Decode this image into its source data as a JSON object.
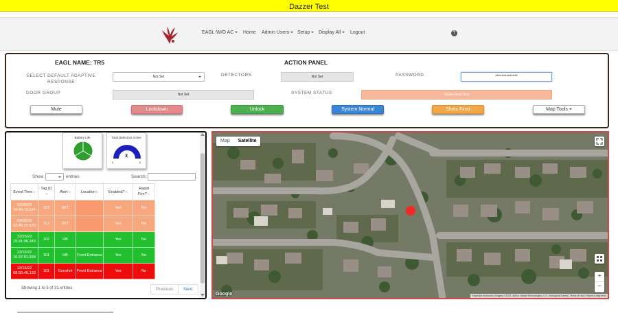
{
  "banner": {
    "title": "Dazzer Test",
    "color": "#ffff00"
  },
  "nav": {
    "items": [
      {
        "label": "EAGL-W/O AC",
        "dropdown": true
      },
      {
        "label": "Home",
        "dropdown": false
      },
      {
        "label": "Admin Users",
        "dropdown": true
      },
      {
        "label": "Setup",
        "dropdown": true
      },
      {
        "label": "Display All",
        "dropdown": true
      },
      {
        "label": "Logout",
        "dropdown": false
      }
    ],
    "help_icon": "?"
  },
  "action_panel": {
    "eagl_name": "EAGL NAME: TR5",
    "title": "ACTION PANEL",
    "labels": {
      "adaptive_response": "SELECT DEFAULT ADAPTIVE RESPONSE",
      "detectors": "DETECTORS",
      "password": "PASSWORD",
      "door_group": "DOOR GROUP",
      "system_status": "SYSTEM STATUS"
    },
    "values": {
      "adaptive_response": "Not Set",
      "detectors": "Not Set",
      "password": "**************",
      "door_group": "Not Set",
      "system_status": "Shots Fired Test"
    },
    "buttons": {
      "mute": "Mute",
      "lockdown": "Lockdown",
      "unlock": "Unlock",
      "system_normal": "System Normal",
      "shots_fired": "Shots Fired",
      "map_tools": "Map Tools"
    },
    "colors": {
      "lockdown": "#e58a8a",
      "unlock": "#4caf50",
      "system_normal": "#3a85d6",
      "shots_fired": "#f0a645",
      "status": "#f7b89a"
    }
  },
  "gauges": {
    "battery": {
      "title": "Battery Life",
      "color": "#2e9e2e"
    },
    "detectors": {
      "title": "Total Detectors Active",
      "value": "3",
      "min": "0",
      "max": "3",
      "color": "#1e1ebf"
    }
  },
  "table": {
    "show_label": "Show",
    "entries_label": "entries",
    "search_label": "Search:",
    "columns": [
      "Event Time",
      "Tag ID",
      "Alert",
      "Location",
      "Enabled?",
      "Rapid Fire?"
    ],
    "rows": [
      {
        "time": "02/08/23 10:40:18.524",
        "tag": "102",
        "alert": "SFT",
        "location": "",
        "enabled": "Yes",
        "rapid": "No",
        "status": "orange"
      },
      {
        "time": "02/08/23 10:40:15.570",
        "tag": "102",
        "alert": "SFT",
        "location": "",
        "enabled": "Yes",
        "rapid": "No",
        "status": "orange"
      },
      {
        "time": "12/15/22 10:41:06.343",
        "tag": "102",
        "alert": "HB",
        "location": "",
        "enabled": "Yes",
        "rapid": "No",
        "status": "green"
      },
      {
        "time": "12/15/22 10:37:01.599",
        "tag": "101",
        "alert": "HB",
        "location": "Front Entrance",
        "enabled": "Yes",
        "rapid": "No",
        "status": "green"
      },
      {
        "time": "12/15/22 08:55:46.133",
        "tag": "101",
        "alert": "Gunshot",
        "location": "Front Entrance",
        "enabled": "Yes",
        "rapid": "No",
        "status": "red"
      }
    ],
    "info": "Showing 1 to 5 of 31 entries",
    "previous": "Previous",
    "next": "Next"
  },
  "map": {
    "type_map": "Map",
    "type_satellite": "Satellite",
    "active_type": "Satellite",
    "google": "Google",
    "attribution": "Keyboard shortcuts | Imagery ©2023, Airbus, Maxar Technologies, U.S. Geological Survey | Terms of Use | Report a map error",
    "zoom_in": "+",
    "zoom_out": "−",
    "marker_color": "#ff2020"
  }
}
